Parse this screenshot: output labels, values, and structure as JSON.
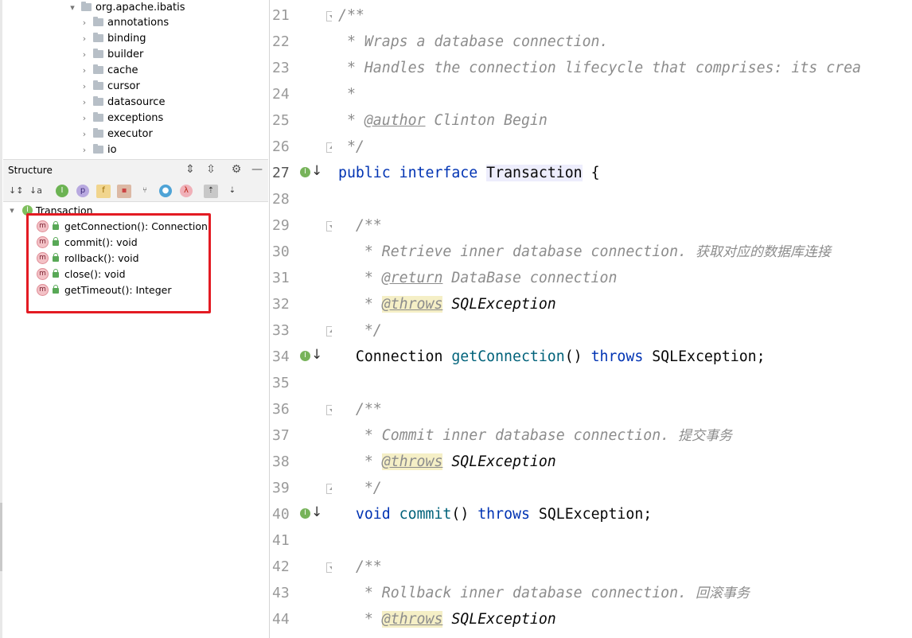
{
  "project_tree": {
    "root": "org.apache.ibatis",
    "children": [
      "annotations",
      "binding",
      "builder",
      "cache",
      "cursor",
      "datasource",
      "exceptions",
      "executor",
      "io"
    ]
  },
  "structure": {
    "title": "Structure",
    "root_label": "Transaction",
    "members": [
      {
        "label": "getConnection(): Connection"
      },
      {
        "label": "commit(): void"
      },
      {
        "label": "rollback(): void"
      },
      {
        "label": "close(): void"
      },
      {
        "label": "getTimeout(): Integer"
      }
    ]
  },
  "editor": {
    "line_numbers": [
      "21",
      "22",
      "23",
      "24",
      "25",
      "26",
      "27",
      "28",
      "29",
      "30",
      "31",
      "32",
      "33",
      "34",
      "35",
      "36",
      "37",
      "38",
      "39",
      "40",
      "41",
      "42",
      "43",
      "44"
    ],
    "l21": "/**",
    "l22": " * Wraps a database connection.",
    "l23": " * Handles the connection lifecycle that comprises: its crea",
    "l24": " *",
    "l25_pre": " * ",
    "l25_tag": "@author",
    "l25_post": " Clinton Begin",
    "l26": " */",
    "l27_kw1": "public",
    "l27_kw2": "interface",
    "l27_name": "Transaction",
    "l27_brace": " {",
    "l29": "  /**",
    "l30": "   * Retrieve inner database connection. ",
    "l30_cn": "获取对应的数据库连接",
    "l31_pre": "   * ",
    "l31_tag": "@return",
    "l31_post": " DataBase connection",
    "l32_pre": "   * ",
    "l32_tag": "@throws",
    "l32_post": " SQLException",
    "l33": "   */",
    "l34_type": "  Connection ",
    "l34_fn": "getConnection",
    "l34_mid": "() ",
    "l34_kw": "throws",
    "l34_post": " SQLException;",
    "l36": "  /**",
    "l37": "   * Commit inner database connection. ",
    "l37_cn": "提交事务",
    "l38_pre": "   * ",
    "l38_tag": "@throws",
    "l38_post": " SQLException",
    "l39": "   */",
    "l40_kw": "void",
    "l40_fn": "commit",
    "l40_mid": "() ",
    "l40_kw2": "throws",
    "l40_post": " SQLException;",
    "l42": "  /**",
    "l43": "   * Rollback inner database connection. ",
    "l43_cn": "回滚事务",
    "l44_pre": "   * ",
    "l44_tag": "@throws",
    "l44_post": " SQLException"
  }
}
